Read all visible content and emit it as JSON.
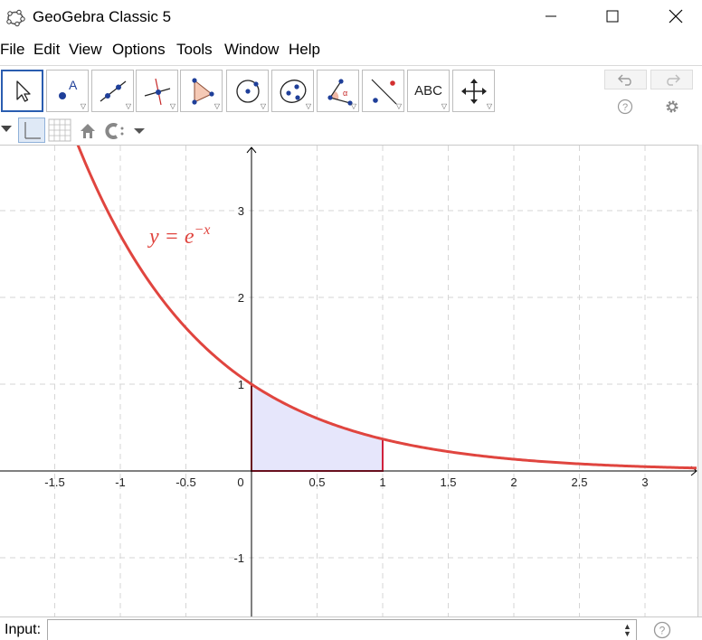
{
  "window": {
    "title": "GeoGebra Classic 5"
  },
  "menu": {
    "items": [
      "File",
      "Edit",
      "View",
      "Options",
      "Tools",
      "Window",
      "Help"
    ]
  },
  "toolbar": {
    "tools": [
      {
        "name": "move-tool",
        "icon": "arrow-pointer-icon",
        "selected": true
      },
      {
        "name": "point-tool",
        "icon": "point-icon",
        "selected": false
      },
      {
        "name": "line-tool",
        "icon": "line-icon",
        "selected": false
      },
      {
        "name": "perpendicular-line-tool",
        "icon": "perpendicular-icon",
        "selected": false
      },
      {
        "name": "polygon-tool",
        "icon": "polygon-icon",
        "selected": false
      },
      {
        "name": "circle-tool",
        "icon": "circle-icon",
        "selected": false
      },
      {
        "name": "conic-tool",
        "icon": "ellipse-icon",
        "selected": false
      },
      {
        "name": "angle-tool",
        "icon": "angle-icon",
        "selected": false
      },
      {
        "name": "reflect-tool",
        "icon": "reflect-icon",
        "selected": false
      },
      {
        "name": "text-tool",
        "icon": "text-icon",
        "label": "ABC",
        "selected": false
      },
      {
        "name": "move-graphics-tool",
        "icon": "move-arrows-icon",
        "selected": false
      }
    ],
    "undo_icon": "undo-icon",
    "redo_icon": "redo-icon",
    "help_icon": "help-icon",
    "settings_icon": "gear-icon"
  },
  "graphics": {
    "x_ticks": [
      "-1.5",
      "-1",
      "-0.5",
      "0",
      "0.5",
      "1",
      "1.5",
      "2",
      "2.5",
      "3"
    ],
    "y_ticks": [
      "3",
      "2",
      "1",
      "-1"
    ],
    "function_label": "y = e",
    "function_label_exponent": "−x",
    "function_color": "#e0453f",
    "region_fill": "#e6e6fb",
    "region_stroke": "#d0213c",
    "shaded_interval": [
      0,
      1
    ]
  },
  "input_bar": {
    "label": "Input:",
    "value": "",
    "help_icon": "help-icon"
  }
}
